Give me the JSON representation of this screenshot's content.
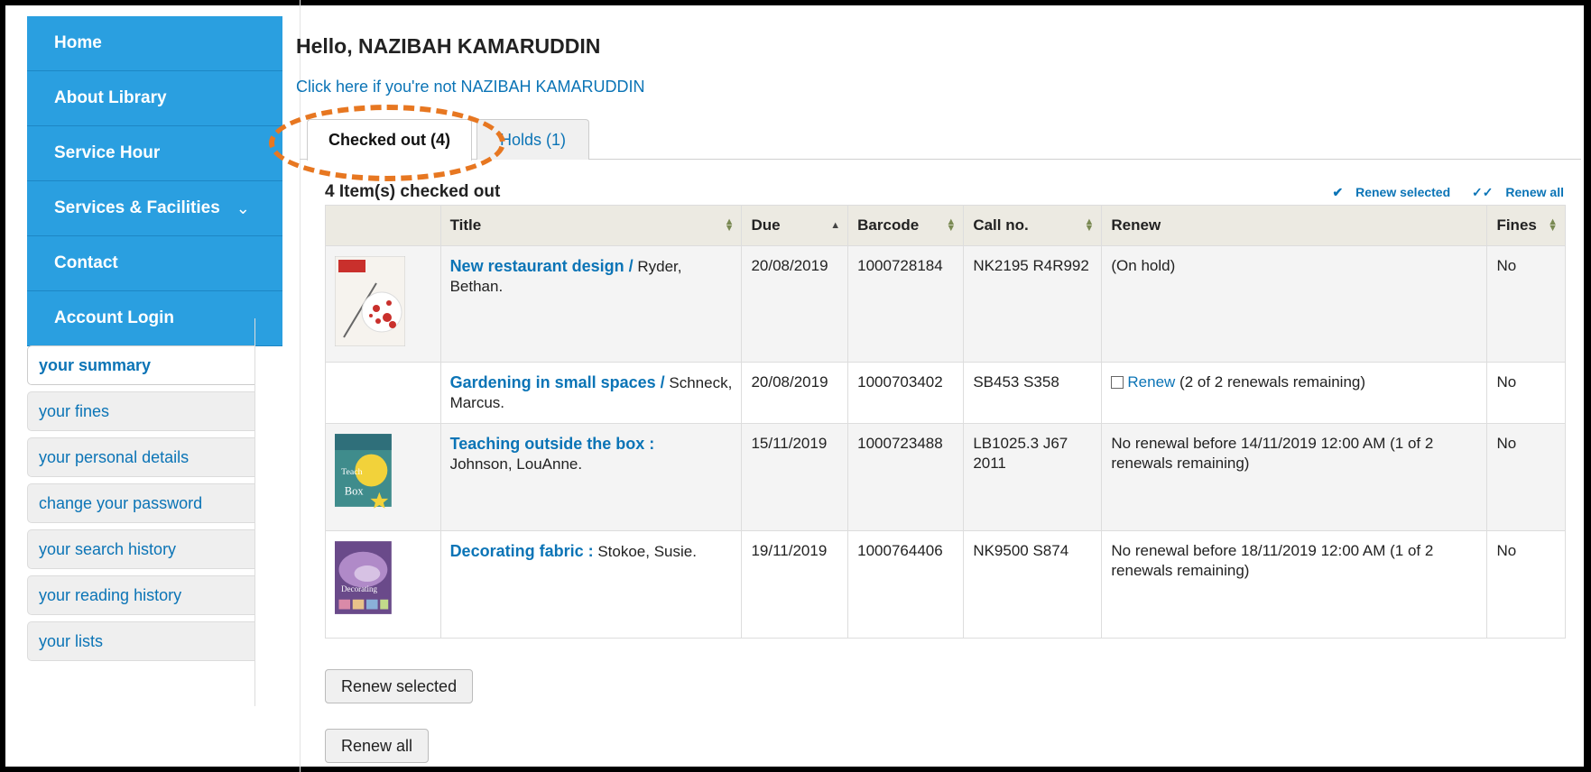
{
  "nav": {
    "items": [
      {
        "label": "Home"
      },
      {
        "label": "About Library"
      },
      {
        "label": "Service Hour"
      },
      {
        "label": "Services & Facilities"
      },
      {
        "label": "Contact"
      },
      {
        "label": "Account Login"
      }
    ]
  },
  "usermenu": {
    "items": [
      {
        "label": "your summary",
        "active": true
      },
      {
        "label": "your fines"
      },
      {
        "label": "your personal details"
      },
      {
        "label": "change your password"
      },
      {
        "label": "your search history"
      },
      {
        "label": "your reading history"
      },
      {
        "label": "your lists"
      }
    ]
  },
  "header": {
    "greeting": "Hello, NAZIBAH KAMARUDDIN",
    "not_you": "Click here if you're not NAZIBAH KAMARUDDIN"
  },
  "tabs": [
    {
      "label": "Checked out (4)",
      "active": true
    },
    {
      "label": "Holds (1)"
    }
  ],
  "checked_out": {
    "title": "4 Item(s) checked out",
    "renew_selected_link": "Renew selected",
    "renew_all_link": "Renew all",
    "columns": [
      "Title",
      "Due",
      "Barcode",
      "Call no.",
      "Renew",
      "Fines"
    ],
    "rows": [
      {
        "title": "New restaurant design /",
        "author": " Ryder, Bethan.",
        "due": "20/08/2019",
        "barcode": "1000728184",
        "callno": "NK2195 R4R992",
        "renew": "(On hold)",
        "fines": "No",
        "cover": "restaurant"
      },
      {
        "title": "Gardening in small spaces /",
        "author": " Schneck, Marcus.",
        "due": "20/08/2019",
        "barcode": "1000703402",
        "callno": "SB453 S358",
        "renew_link": "Renew",
        "renew": " (2 of 2 renewals remaining)",
        "fines": "No",
        "cover": ""
      },
      {
        "title": "Teaching outside the box :",
        "author": " Johnson, LouAnne.",
        "due": "15/11/2019",
        "barcode": "1000723488",
        "callno": "LB1025.3 J67 2011",
        "renew": "No renewal before 14/11/2019 12:00 AM (1 of 2 renewals remaining)",
        "fines": "No",
        "cover": "teaching"
      },
      {
        "title": "Decorating fabric :",
        "author": " Stokoe, Susie.",
        "due": "19/11/2019",
        "barcode": "1000764406",
        "callno": "NK9500 S874",
        "renew": "No renewal before 18/11/2019 12:00 AM (1 of 2 renewals remaining)",
        "fines": "No",
        "cover": "fabric"
      }
    ]
  },
  "buttons": {
    "renew_selected": "Renew selected",
    "renew_all": "Renew all"
  },
  "colors": {
    "nav_bg": "#2a9fe0",
    "link": "#0b74b6",
    "highlight": "#e77721"
  }
}
